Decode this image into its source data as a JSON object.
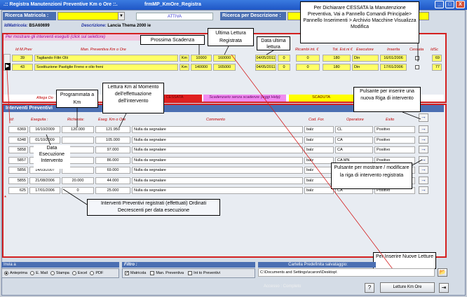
{
  "window": {
    "title": ".:: Registra Manutenzioni Preventive Km o Ore ::.",
    "form_name": "frmMP_KmOre_Registra",
    "buttons": [
      "_",
      "□",
      "X"
    ]
  },
  "search": {
    "matricola_label": "Ricerca Matricola :",
    "status": "ATTIVA",
    "descrizione_label": "Ricerca per Descrizione :"
  },
  "info": {
    "idmatricola_label": "IdMatricola:",
    "idmatricola_value": "BSA60699",
    "descrizione_label": "Descrizione:",
    "descrizione_value": "Lancia Thema 2000 ie"
  },
  "upper_section": {
    "bar_label": "Per mostrare  gli interventi eseguiti (click sul selettore)",
    "headers": [
      "Id M.Prev",
      "Man. Preventiva Km o Ore",
      "",
      "Ricambi int. €",
      "Tot. Est.ni €",
      "Esecutore",
      "Inserita",
      "Cessata",
      "IdSc"
    ],
    "rows": [
      {
        "id": "39",
        "desc": "Tagliando Filtri Olii",
        "unit": "Km",
        "prog": "10000",
        "last": "160000",
        "date": "04/05/2011",
        "ric": "0",
        "a": "0",
        "tot": "180",
        "exec": "Din",
        "ins": "16/01/2006",
        "idsc": "69"
      },
      {
        "id": "43",
        "desc": "Sostituzione Pastiglie Freno e olio freni",
        "unit": "Km",
        "prog": "140000",
        "last": "165000",
        "date": "04/05/2011",
        "ric": "0",
        "a": "0",
        "tot": "180",
        "exec": "Din",
        "ins": "17/01/2006",
        "idsc": "77"
      }
    ],
    "legend": {
      "allega": "Allega Do",
      "cessata": "CESSATA",
      "scadenzario": "Scadenzario senza scadenze (leggi Help)",
      "scaduta": "SCADUTA"
    }
  },
  "interventi": {
    "bar_label": "Interventi Preventivi",
    "headers": [
      "Id:",
      "Eseguita :",
      "Richiesta:",
      "Eseg. Km o Ore",
      "Commento",
      "Cod. For.",
      "Operatore",
      "Esito"
    ],
    "rows": [
      {
        "id": "6369",
        "eseguita": "16/10/2009",
        "richiesta": "120.000",
        "eseg": "121.950",
        "commento": "Nulla da segnalare",
        "codfor": "balz",
        "operatore": "CL",
        "esito": "Positivo"
      },
      {
        "id": "6348",
        "eseguita": "01/10/2009",
        "richiesta": "",
        "eseg": "105.000",
        "commento": "Nulla da segnalare",
        "codfor": "balz",
        "operatore": "CA",
        "esito": "Positivo"
      },
      {
        "id": "5858",
        "eseguita": "",
        "richiesta": "",
        "eseg": "97.000",
        "commento": "Nulla da segnalare",
        "codfor": "balz",
        "operatore": "CA",
        "esito": "Positivo"
      },
      {
        "id": "5857",
        "eseguita": "",
        "richiesta": "",
        "eseg": "86.000",
        "commento": "Nulla da segnalare",
        "codfor": "balz",
        "operatore": "CA MN",
        "esito": "Positivo"
      },
      {
        "id": "5856",
        "eseguita": "14/03/2007",
        "richiesta": "",
        "eseg": "69.000",
        "commento": "Nulla da segnalare",
        "codfor": "balz",
        "operatore": "CA MN",
        "esito": "Positivo"
      },
      {
        "id": "5855",
        "eseguita": "21/08/2006",
        "richiesta": "20.000",
        "eseg": "44.000",
        "commento": "Nulla da segnalare",
        "codfor": "balz",
        "operatore": "CA",
        "esito": "Positivo"
      },
      {
        "id": "625",
        "eseguita": "17/01/2006",
        "richiesta": "0",
        "eseg": "25.000",
        "commento": "Nulla da segnalare",
        "codfor": "balz",
        "operatore": "CA",
        "esito": "Positivo"
      }
    ],
    "new_row_symbol": "*"
  },
  "annotations": {
    "cessata": "Per Dichiarare CESSATA la Manutenzione Preventiva,  Vai a Pannello Comandi Principale> Pannello Inserimenti > Archivio Macchine Visualizza Modifica",
    "prossima": "Prossima Scadenza",
    "ultima": "Ultima Lettura Registrata",
    "data_ultima": "Data ultima lettura",
    "programmata": "Programmata a Km",
    "lettura_km": "Lettura Km al Momento dell'effettuazione dell'intervento",
    "pulsante_nuova": "Pulsante per inserire una nuova Riga di intervento",
    "pulsante_mostra": "Pulsante per mostrare / modificare la riga di intervento registrata",
    "data_esecuzione": "Data Esecuzione Intervento",
    "interventi_registrati": "Interventi Preventivi registrati (effettuati) Ordinati Decrescenti per data esecuzione",
    "inserire_letture": "Per Inserire Nuove Letture"
  },
  "bottom": {
    "invia_label": "Invia a",
    "invia_options": [
      "Anteprima",
      "E. Mail",
      "Stampa",
      "Excel",
      "PDF"
    ],
    "filtro_label": "Filtro :",
    "filtro_options": [
      "Matricola",
      "Man. Preventiva",
      "Int to Preventivi"
    ],
    "cartella_label": "Cartella Predefinita salvataggio:",
    "cartella_path": "C:\\Documents and Settings\\scaroni\\Desktop\\",
    "accesso": "Accesso : Completo",
    "letture_button": "Letture Km Ore"
  }
}
